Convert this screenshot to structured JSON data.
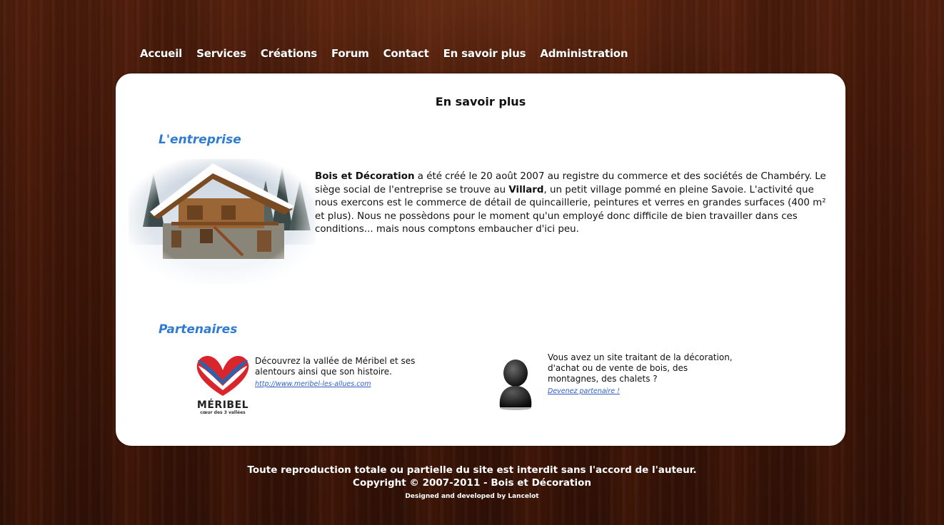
{
  "nav": {
    "items": [
      "Accueil",
      "Services",
      "Créations",
      "Forum",
      "Contact",
      "En savoir plus",
      "Administration"
    ]
  },
  "page": {
    "title": "En savoir plus"
  },
  "entreprise": {
    "heading": "L'entreprise",
    "company_name": "Bois et Décoration",
    "text_1": " a été créé le 20 août 2007 au registre du commerce et des sociétés de Chambéry. Le siège social de l'entreprise se trouve au ",
    "village": "Villard",
    "text_2": ", un petit village pommé en pleine Savoie. L'activité que nous exercons est le commerce de détail de quincaillerie, peintures et verres en grandes surfaces (400 m² et plus). Nous ne possèdons pour le moment qu'un employé donc difficile de bien travailler dans ces conditions... mais nous comptons embaucher d'ici peu."
  },
  "partenaires": {
    "heading": "Partenaires",
    "meribel": {
      "logo_text": "MÉRIBEL",
      "logo_subtext": "cœur des 3 vallées",
      "description": "Découvrez la vallée de Méribel et ses alentours ainsi que son histoire.",
      "link": "http://www.meribel-les-allues.com"
    },
    "become": {
      "description": "Vous avez un site traitant de la décoration, d'achat ou de vente de bois, des montagnes, des chalets ?",
      "link": "Devenez partenaire !"
    }
  },
  "footer": {
    "line1": "Toute reproduction totale ou partielle du site est interdit sans l'accord de l'auteur.",
    "line2": "Copyright © 2007-2011 - Bois et Décoration",
    "line3": "Designed and developed by Lancelot"
  },
  "colors": {
    "heading_blue": "#2f7bd2",
    "link_blue": "#2f5fc4",
    "wood_brown": "#3d1608"
  }
}
